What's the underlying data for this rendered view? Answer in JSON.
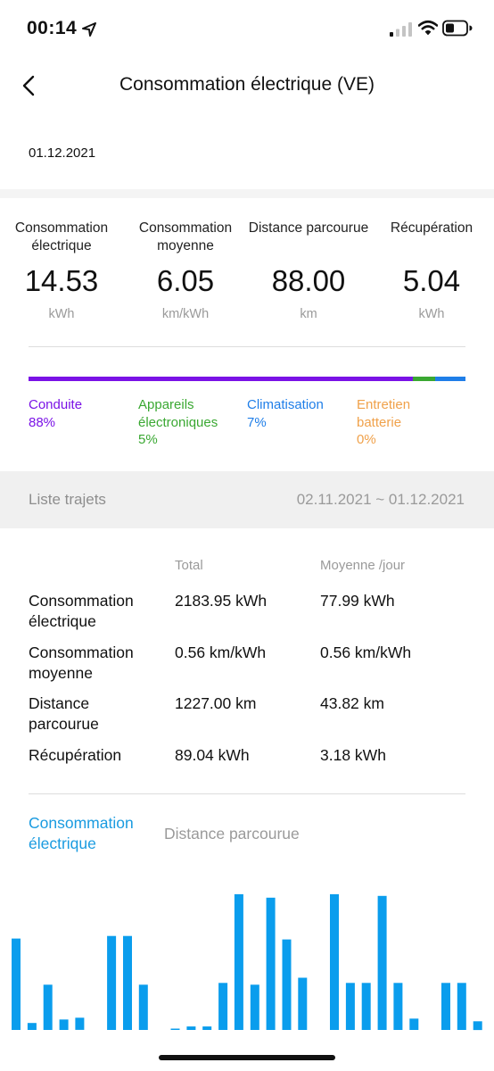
{
  "status_bar": {
    "time": "00:14"
  },
  "header": {
    "title": "Consommation électrique (VE)"
  },
  "date": "01.12.2021",
  "stats": [
    {
      "label": "Consommation électrique",
      "value": "14.53",
      "unit": "kWh"
    },
    {
      "label": "Consommation moyenne",
      "value": "6.05",
      "unit": "km/kWh"
    },
    {
      "label": "Distance parcourue",
      "value": "88.00",
      "unit": "km"
    },
    {
      "label": "Récupération",
      "value": "5.04",
      "unit": "kWh"
    }
  ],
  "breakdown": [
    {
      "label": "Conduite",
      "percent": "88%",
      "fraction": 0.88,
      "color": "#7a12e6"
    },
    {
      "label": "Appareils électroniques",
      "percent": "5%",
      "fraction": 0.05,
      "color": "#3aa832"
    },
    {
      "label": "Climatisation",
      "percent": "7%",
      "fraction": 0.07,
      "color": "#1f7ee8"
    },
    {
      "label": "Entretien batterie",
      "percent": "0%",
      "fraction": 0.0,
      "color": "#f0a14a"
    }
  ],
  "trips": {
    "label": "Liste trajets",
    "range": "02.11.2021 ~ 01.12.2021"
  },
  "summary": {
    "col_total": "Total",
    "col_avg": "Moyenne /jour",
    "rows": [
      {
        "label": "Consommation électrique",
        "total": "2183.95 kWh",
        "avg": "77.99 kWh"
      },
      {
        "label": "Consommation moyenne",
        "total": "0.56 km/kWh",
        "avg": "0.56 km/kWh"
      },
      {
        "label": "Distance parcourue",
        "total": "1227.00 km",
        "avg": "43.82 km"
      },
      {
        "label": "Récupération",
        "total": "89.04 kWh",
        "avg": "3.18 kWh"
      }
    ]
  },
  "chart_tabs": {
    "active": "Consommation électrique",
    "inactive": "Distance parcourue"
  },
  "chart_data": {
    "type": "bar",
    "color": "#0a9ded",
    "values": [
      105,
      8,
      52,
      12,
      14,
      0,
      108,
      108,
      52,
      0,
      1,
      4,
      4,
      54,
      156,
      52,
      152,
      104,
      60,
      0,
      156,
      54,
      54,
      154,
      54,
      13,
      0,
      54,
      54,
      10
    ],
    "ymax": 160
  }
}
